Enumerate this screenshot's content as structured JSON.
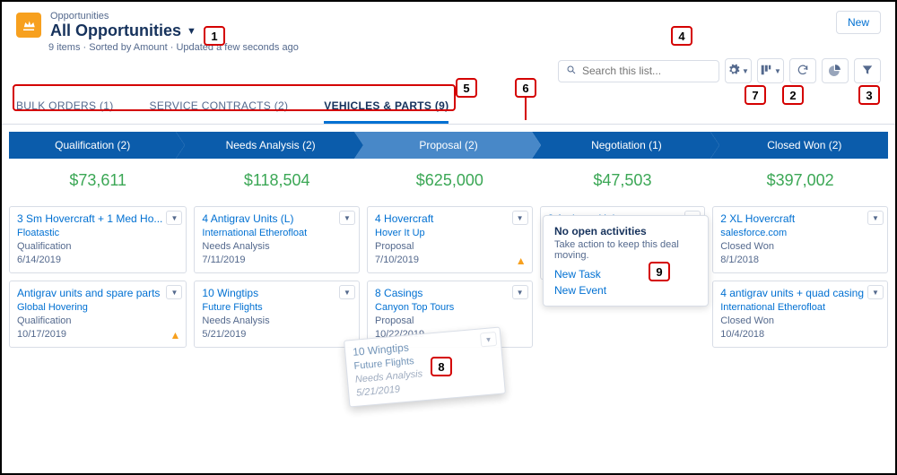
{
  "header": {
    "small": "Opportunities",
    "main": "All Opportunities",
    "new_button": "New"
  },
  "subinfo": "9 items · Sorted by Amount · Updated a few seconds ago",
  "search_placeholder": "Search this list...",
  "tabs": [
    {
      "label": "BULK ORDERS (1)",
      "active": false
    },
    {
      "label": "SERVICE CONTRACTS (2)",
      "active": false
    },
    {
      "label": "VEHICLES & PARTS (9)",
      "active": true
    }
  ],
  "stages": [
    {
      "label": "Qualification   (2)"
    },
    {
      "label": "Needs Analysis   (2)"
    },
    {
      "label": "Proposal   (2)"
    },
    {
      "label": "Negotiation   (1)"
    },
    {
      "label": "Closed Won   (2)"
    }
  ],
  "columns": [
    {
      "sum": "$73,611",
      "cards": [
        {
          "title": "3 Sm Hovercraft + 1 Med Ho...",
          "account": "Floatastic",
          "stage": "Qualification",
          "date": "6/14/2019",
          "warn": false
        },
        {
          "title": "Antigrav units and spare parts",
          "account": "Global Hovering",
          "stage": "Qualification",
          "date": "10/17/2019",
          "warn": true
        }
      ]
    },
    {
      "sum": "$118,504",
      "cards": [
        {
          "title": "4 Antigrav Units (L)",
          "account": "International Etherofloat",
          "stage": "Needs Analysis",
          "date": "7/11/2019",
          "warn": false
        },
        {
          "title": "10 Wingtips",
          "account": "Future Flights",
          "stage": "Needs Analysis",
          "date": "5/21/2019",
          "warn": false
        }
      ]
    },
    {
      "sum": "$625,000",
      "cards": [
        {
          "title": "4 Hovercraft",
          "account": "Hover It Up",
          "stage": "Proposal",
          "date": "7/10/2019",
          "warn": true
        },
        {
          "title": "8 Casings",
          "account": "Canyon Top Tours",
          "stage": "Proposal",
          "date": "10/22/2019",
          "warn": false
        }
      ]
    },
    {
      "sum": "$47,503",
      "cards": [
        {
          "title": "3 Antigrav Units",
          "account": "",
          "stage": "",
          "date": "",
          "warn": false
        }
      ]
    },
    {
      "sum": "$397,002",
      "cards": [
        {
          "title": "2 XL Hovercraft",
          "account": "salesforce.com",
          "stage": "Closed Won",
          "date": "8/1/2018",
          "warn": false
        },
        {
          "title": "4 antigrav units + quad casing",
          "account": "International Etherofloat",
          "stage": "Closed Won",
          "date": "10/4/2018",
          "warn": false
        }
      ]
    }
  ],
  "popover": {
    "title": "No open activities",
    "desc": "Take action to keep this deal moving.",
    "link1": "New Task",
    "link2": "New Event"
  },
  "ghost": {
    "title": "10 Wingtips",
    "account": "Future Flights",
    "stage": "Needs Analysis",
    "date": "5/21/2019"
  },
  "callouts": {
    "1": "1",
    "2": "2",
    "3": "3",
    "4": "4",
    "5": "5",
    "6": "6",
    "7": "7",
    "8": "8",
    "9": "9"
  }
}
